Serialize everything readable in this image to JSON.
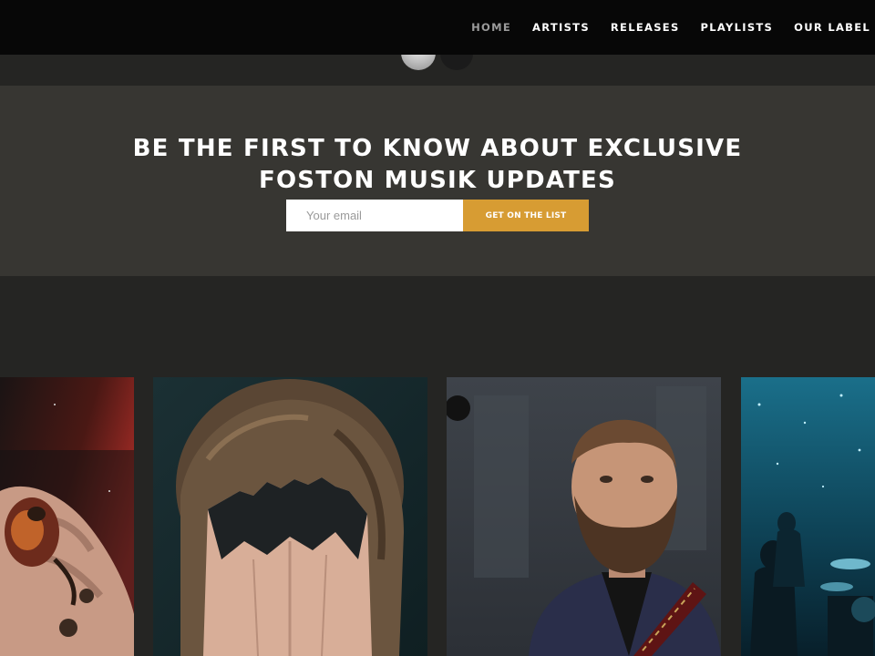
{
  "nav": {
    "items": [
      {
        "label": "HOME",
        "active": true
      },
      {
        "label": "ARTISTS",
        "active": false
      },
      {
        "label": "RELEASES",
        "active": false
      },
      {
        "label": "PLAYLISTS",
        "active": false
      },
      {
        "label": "OUR LABEL",
        "active": false
      }
    ]
  },
  "newsletter": {
    "title_line1": "Be the first to know about exclusive",
    "title_line2": "Foston Musik updates",
    "email_placeholder": "Your email",
    "button_label": "Get on the list"
  },
  "colors": {
    "nav_bg": "#070707",
    "page_bg": "#252523",
    "newsletter_bg": "#373632",
    "accent": "#d79c33",
    "nav_active": "#9b9b9b"
  },
  "cards": [
    {
      "subject": "tattooed-hand-photo"
    },
    {
      "subject": "person-covering-face-photo"
    },
    {
      "subject": "bearded-guitarist-photo"
    },
    {
      "subject": "band-on-stage-photo"
    }
  ]
}
